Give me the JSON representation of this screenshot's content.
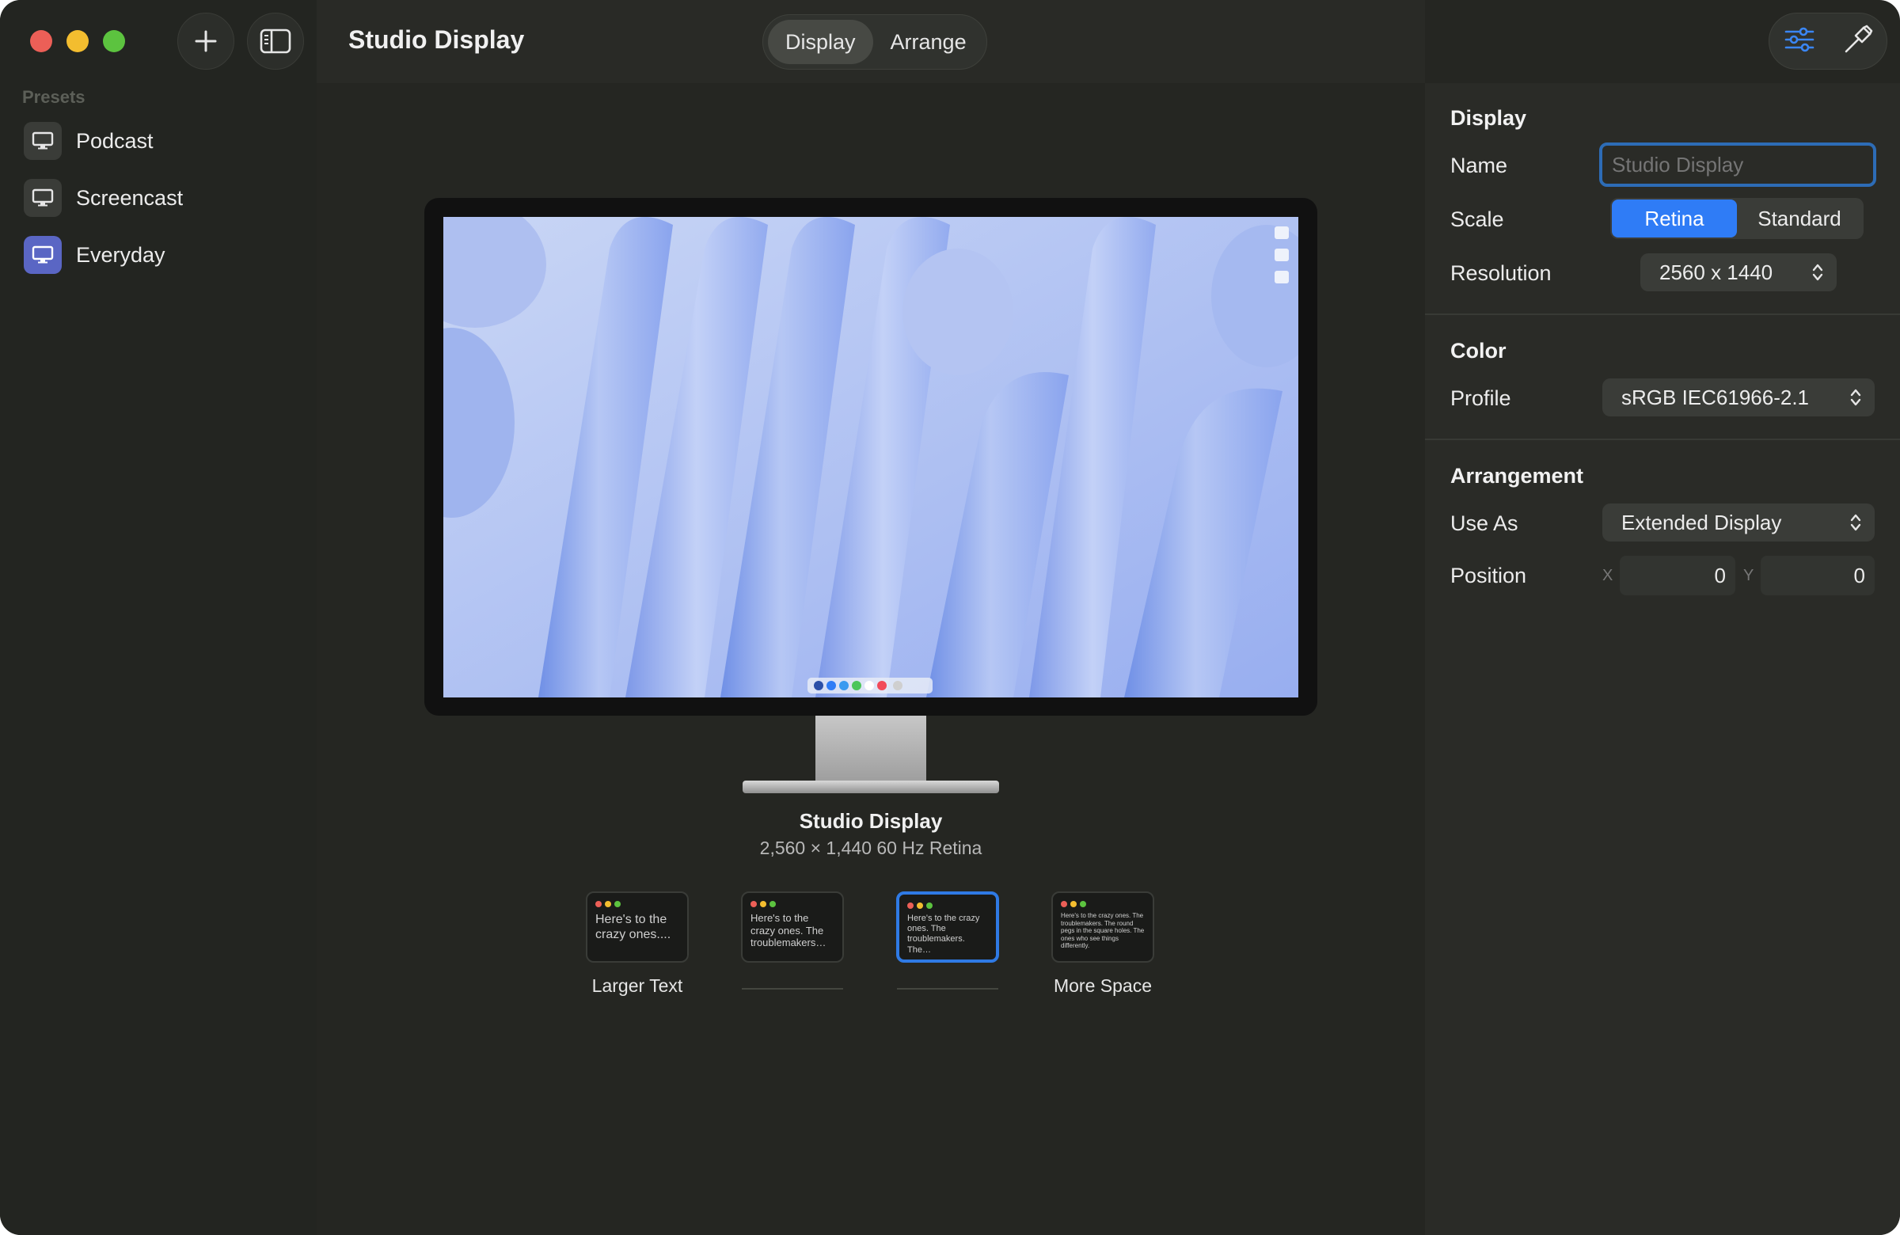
{
  "window": {
    "title": "Studio Display",
    "accent_color": "#2f7cf6"
  },
  "toolbar": {
    "add_icon": "plus-icon",
    "sidebar_toggle_icon": "sidebar-icon",
    "tabs": [
      {
        "label": "Display",
        "active": true
      },
      {
        "label": "Arrange",
        "active": false
      }
    ],
    "right_icons": [
      "sliders-icon",
      "hammer-icon"
    ]
  },
  "sidebar": {
    "section_label": "Presets",
    "items": [
      {
        "label": "Podcast",
        "icon": "display-icon",
        "active": false
      },
      {
        "label": "Screencast",
        "icon": "display-icon",
        "active": false
      },
      {
        "label": "Everyday",
        "icon": "display-icon",
        "active": true
      }
    ]
  },
  "monitor": {
    "name": "Studio Display",
    "meta": "2,560 × 1,440  60 Hz  Retina"
  },
  "resolution_options": [
    {
      "label": "Larger Text",
      "sample": "Here's to the crazy ones....",
      "selected": false
    },
    {
      "label": "",
      "sample": "Here's to the crazy ones. The troublemakers…",
      "selected": false
    },
    {
      "label": "",
      "sample": "Here's to the crazy ones. The troublemakers. The…",
      "selected": true
    },
    {
      "label": "More Space",
      "sample": "Here's to the crazy ones. The troublemakers. The round pegs in the square holes. The ones who see things differently.",
      "selected": false
    }
  ],
  "inspector": {
    "display": {
      "heading": "Display",
      "name_label": "Name",
      "name_placeholder": "Studio Display",
      "scale_label": "Scale",
      "scale_options": [
        "Retina",
        "Standard"
      ],
      "scale_selected": "Retina",
      "resolution_label": "Resolution",
      "resolution_value": "2560 x 1440"
    },
    "color": {
      "heading": "Color",
      "profile_label": "Profile",
      "profile_value": "sRGB IEC61966-2.1"
    },
    "arrangement": {
      "heading": "Arrangement",
      "use_as_label": "Use As",
      "use_as_value": "Extended Display",
      "position_label": "Position",
      "x_label": "X",
      "x_value": "0",
      "y_label": "Y",
      "y_value": "0"
    }
  }
}
